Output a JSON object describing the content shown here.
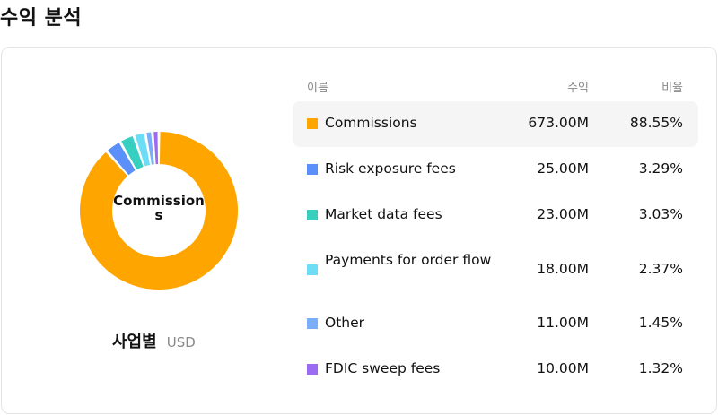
{
  "page": {
    "title": "수익 분석"
  },
  "chart": {
    "center_label": "Commissions",
    "footer_label": "사업별",
    "footer_unit": "USD"
  },
  "table": {
    "headers": {
      "name": "이름",
      "revenue": "수익",
      "percent": "비율"
    },
    "rows": [
      {
        "name": "Commissions",
        "revenue": "673.00M",
        "percent": "88.55%",
        "color": "#FFA500"
      },
      {
        "name": "Risk exposure fees",
        "revenue": "25.00M",
        "percent": "3.29%",
        "color": "#5B8FF9"
      },
      {
        "name": "Market data fees",
        "revenue": "23.00M",
        "percent": "3.03%",
        "color": "#36CFC0"
      },
      {
        "name": "Payments for order flow",
        "revenue": "18.00M",
        "percent": "2.37%",
        "color": "#6DDCF5"
      },
      {
        "name": "Other",
        "revenue": "11.00M",
        "percent": "1.45%",
        "color": "#7BAEF8"
      },
      {
        "name": "FDIC sweep fees",
        "revenue": "10.00M",
        "percent": "1.32%",
        "color": "#9B6BF2"
      }
    ]
  },
  "chart_data": {
    "type": "pie",
    "categories": [
      "Commissions",
      "Risk exposure fees",
      "Market data fees",
      "Payments for order flow",
      "Other",
      "FDIC sweep fees"
    ],
    "values": [
      673,
      25,
      23,
      18,
      11,
      10
    ],
    "percent": [
      88.55,
      3.29,
      3.03,
      2.37,
      1.45,
      1.32
    ],
    "colors": [
      "#FFA500",
      "#5B8FF9",
      "#36CFC0",
      "#6DDCF5",
      "#7BAEF8",
      "#9B6BF2"
    ],
    "title": "",
    "legend": "right"
  }
}
